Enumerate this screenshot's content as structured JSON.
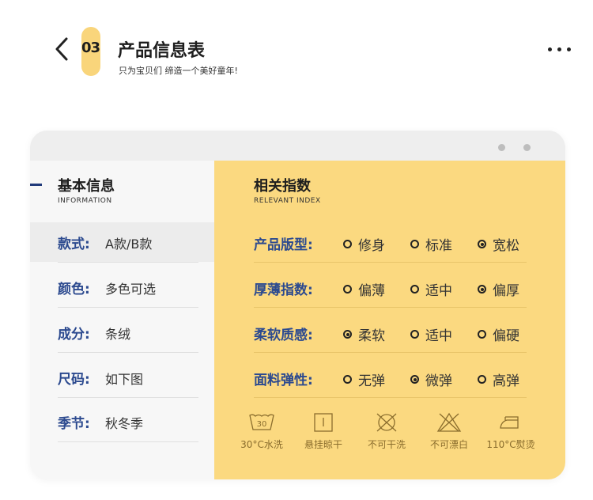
{
  "header": {
    "number": "03",
    "title": "产品信息表",
    "subtitle": "只为宝贝们 缔造一个美好童年!"
  },
  "left_panel": {
    "title": "基本信息",
    "subtitle": "INFORMATION",
    "rows": [
      {
        "label": "款式:",
        "value": "A款/B款"
      },
      {
        "label": "颜色:",
        "value": "多色可选"
      },
      {
        "label": "成分:",
        "value": "条绒"
      },
      {
        "label": "尺码:",
        "value": "如下图"
      },
      {
        "label": "季节:",
        "value": "秋冬季"
      }
    ]
  },
  "right_panel": {
    "title": "相关指数",
    "subtitle": "RELEVANT INDEX",
    "rows": [
      {
        "label": "产品版型:",
        "options": [
          "修身",
          "标准",
          "宽松"
        ],
        "selected": 2
      },
      {
        "label": "厚薄指数:",
        "options": [
          "偏薄",
          "适中",
          "偏厚"
        ],
        "selected": 2
      },
      {
        "label": "柔软质感:",
        "options": [
          "柔软",
          "适中",
          "偏硬"
        ],
        "selected": 0
      },
      {
        "label": "面料弹性:",
        "options": [
          "无弹",
          "微弹",
          "高弹"
        ],
        "selected": 1
      }
    ],
    "care": [
      {
        "icon": "wash-30-icon",
        "label": "30°C水洗",
        "symbol": "30"
      },
      {
        "icon": "hang-dry-icon",
        "label": "悬挂晾干"
      },
      {
        "icon": "no-tumble-dry-icon",
        "label": "不可干洗"
      },
      {
        "icon": "no-bleach-icon",
        "label": "不可漂白"
      },
      {
        "icon": "iron-icon",
        "label": "110°C熨烫"
      }
    ]
  },
  "colors": {
    "accent_yellow": "#fbd980",
    "label_blue": "#2c4a8f"
  }
}
